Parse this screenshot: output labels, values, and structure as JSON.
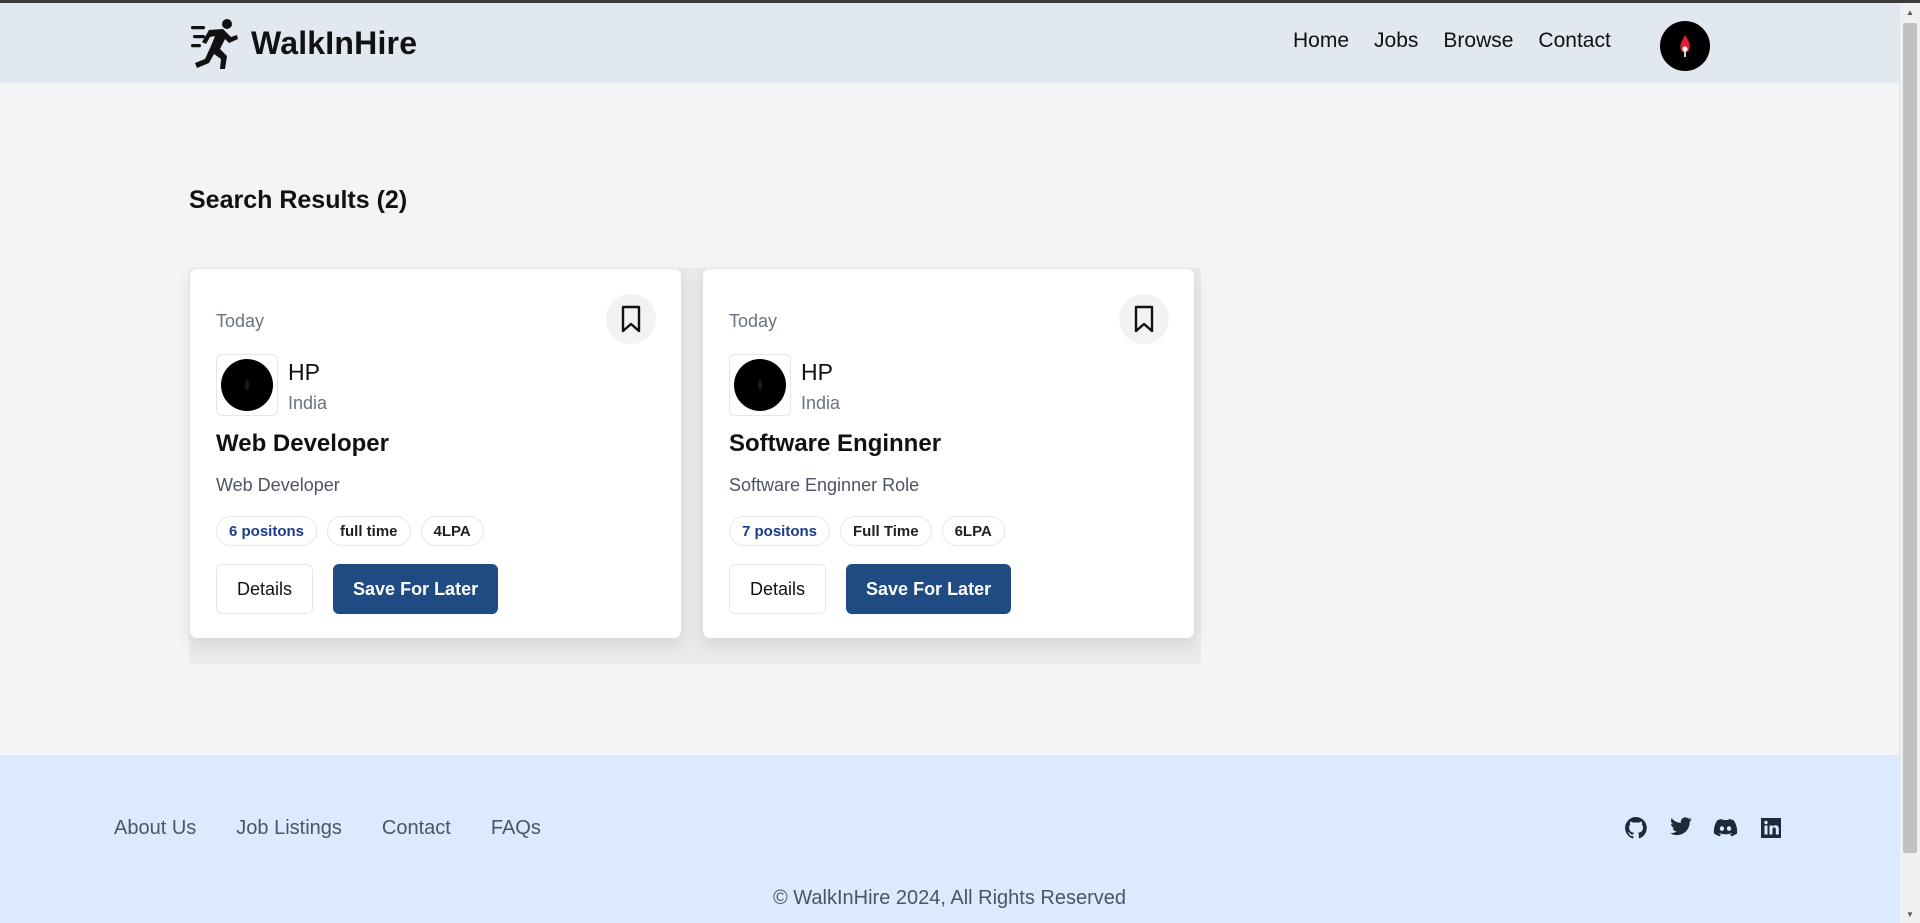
{
  "brand": {
    "name": "WalkInHire",
    "logo_icon": "running-man-icon"
  },
  "nav": {
    "links": [
      "Home",
      "Jobs",
      "Browse",
      "Contact"
    ],
    "avatar_icon": "user-avatar"
  },
  "results": {
    "title": "Search Results (2)"
  },
  "jobs": [
    {
      "date": "Today",
      "company": "HP",
      "location": "India",
      "title": "Web Developer",
      "description": "Web Developer",
      "positions": "6 positons",
      "job_type": "full time",
      "salary": "4LPA",
      "details_label": "Details",
      "save_label": "Save For Later"
    },
    {
      "date": "Today",
      "company": "HP",
      "location": "India",
      "title": "Software Enginner",
      "description": "Software Enginner Role",
      "positions": "7 positons",
      "job_type": "Full Time",
      "salary": "6LPA",
      "details_label": "Details",
      "save_label": "Save For Later"
    }
  ],
  "footer": {
    "links": [
      "About Us",
      "Job Listings",
      "Contact",
      "FAQs"
    ],
    "social_icons": [
      "github-icon",
      "twitter-icon",
      "discord-icon",
      "linkedin-icon"
    ],
    "copyright": "© WalkInHire 2024, All Rights Reserved"
  },
  "colors": {
    "navbar_bg": "#e2e8f0",
    "page_bg": "#f3f4f6",
    "footer_bg": "#dbeafe",
    "primary_button": "#1f4a82"
  }
}
